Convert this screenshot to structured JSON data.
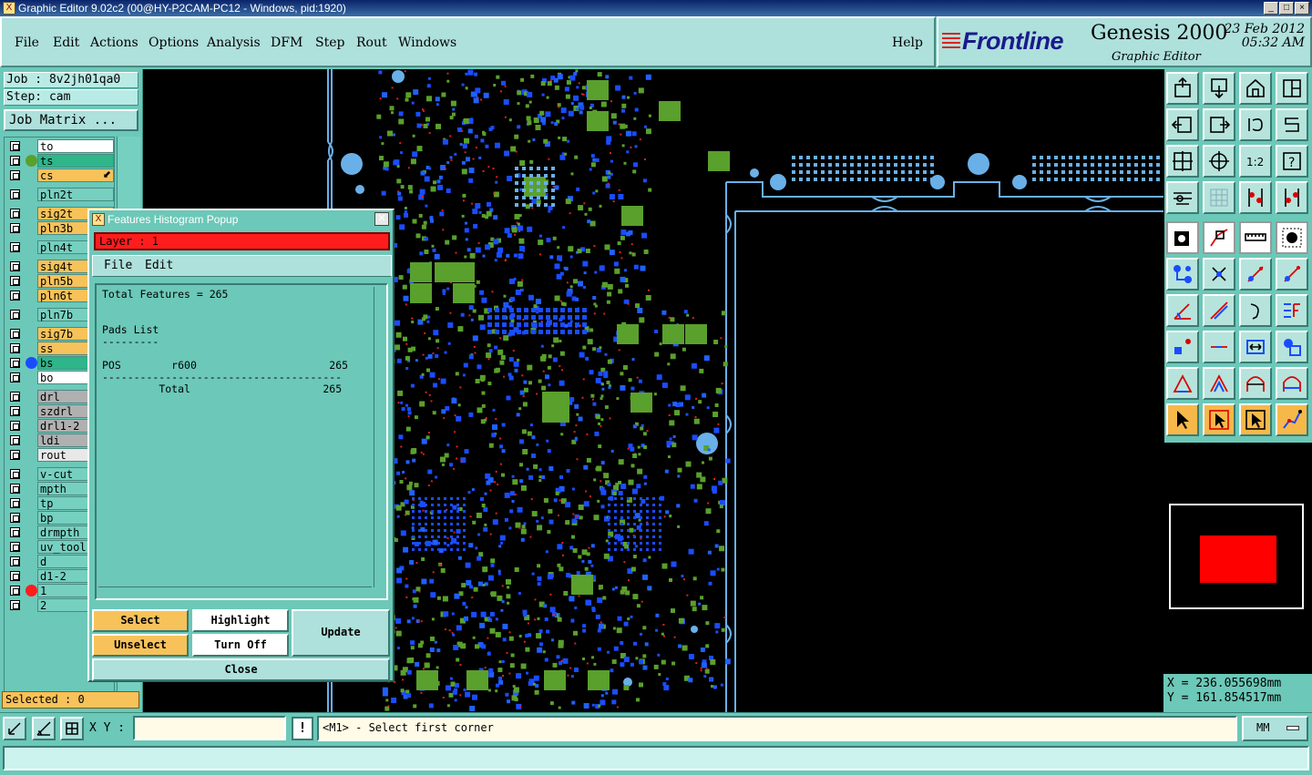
{
  "window": {
    "title": "Graphic Editor 9.02c2 (00@HY-P2CAM-PC12 - Windows, pid:1920)",
    "buttons": [
      "_",
      "□",
      "×"
    ]
  },
  "menu": {
    "items": [
      "File",
      "Edit",
      "Actions",
      "Options",
      "Analysis",
      "DFM",
      "Step",
      "Rout",
      "Windows"
    ],
    "help": "Help"
  },
  "brand": {
    "logo": "Frontline",
    "product": "Genesis 2000",
    "subtitle": "Graphic Editor",
    "date": "23 Feb 2012",
    "time": "05:32 AM"
  },
  "left": {
    "job": "Job : 8v2jh01qa0",
    "step": "Step: cam",
    "job_matrix": "Job Matrix ...",
    "selected": "Selected : 0",
    "layers": [
      {
        "name": "to",
        "bg": "#ffffff",
        "dot": ""
      },
      {
        "name": "ts",
        "bg": "#2fb58a",
        "dot": "#5aa02c"
      },
      {
        "name": "cs",
        "bg": "#f7c25a",
        "dot": "",
        "mark": "⬋"
      },
      {
        "name": "pln2t",
        "bg": "#76d0c0",
        "dot": ""
      },
      {
        "name": "sig2t",
        "bg": "#f7c25a",
        "dot": ""
      },
      {
        "name": "pln3b",
        "bg": "#f7c25a",
        "dot": ""
      },
      {
        "name": "pln4t",
        "bg": "#76d0c0",
        "dot": ""
      },
      {
        "name": "sig4t",
        "bg": "#f7c25a",
        "dot": ""
      },
      {
        "name": "pln5b",
        "bg": "#f7c25a",
        "dot": ""
      },
      {
        "name": "pln6t",
        "bg": "#f7c25a",
        "dot": ""
      },
      {
        "name": "pln7b",
        "bg": "#76d0c0",
        "dot": ""
      },
      {
        "name": "sig7b",
        "bg": "#f7c25a",
        "dot": ""
      },
      {
        "name": "ss",
        "bg": "#f7c25a",
        "dot": ""
      },
      {
        "name": "bs",
        "bg": "#2fb58a",
        "dot": "#1a4cff"
      },
      {
        "name": "bo",
        "bg": "#ffffff",
        "dot": ""
      },
      {
        "name": "drl",
        "bg": "#b0b0b0",
        "dot": ""
      },
      {
        "name": "szdrl",
        "bg": "#b0b0b0",
        "dot": ""
      },
      {
        "name": "drl1-2",
        "bg": "#b0b0b0",
        "dot": ""
      },
      {
        "name": "ldi",
        "bg": "#b0b0b0",
        "dot": ""
      },
      {
        "name": "rout",
        "bg": "#e8e8e8",
        "dot": ""
      },
      {
        "name": "v-cut",
        "bg": "#76d0c0",
        "dot": ""
      },
      {
        "name": "mpth",
        "bg": "#76d0c0",
        "dot": ""
      },
      {
        "name": "tp",
        "bg": "#76d0c0",
        "dot": ""
      },
      {
        "name": "bp",
        "bg": "#76d0c0",
        "dot": ""
      },
      {
        "name": "drmpth",
        "bg": "#76d0c0",
        "dot": ""
      },
      {
        "name": "uv_tool",
        "bg": "#76d0c0",
        "dot": ""
      },
      {
        "name": "d",
        "bg": "#76d0c0",
        "dot": ""
      },
      {
        "name": "d1-2",
        "bg": "#76d0c0",
        "dot": ""
      },
      {
        "name": "1",
        "bg": "#76d0c0",
        "dot": "#ff1c1c"
      },
      {
        "name": "2",
        "bg": "#76d0c0",
        "dot": ""
      }
    ]
  },
  "popup": {
    "title": "Features Histogram Popup",
    "layer": "Layer :  1",
    "menu": [
      "File",
      "Edit"
    ],
    "report": {
      "total": "Total Features = 265",
      "section": "Pads List",
      "underline": "---------",
      "row": {
        "type": "POS",
        "symbol": "r600",
        "count": "265"
      },
      "divider": "--------------------------------------",
      "total_label": "Total",
      "total_count": "265"
    },
    "buttons": {
      "select": "Select",
      "highlight": "Highlight",
      "update": "Update",
      "unselect": "Unselect",
      "turn_off": "Turn Off",
      "close": "Close"
    }
  },
  "right": {
    "x": "X = 236.055698mm",
    "y": "Y = 161.854517mm"
  },
  "bottom": {
    "xy_label": "X Y :",
    "xy_value": "",
    "bang": "!",
    "prompt": "<M1> - Select first corner",
    "units": "MM"
  }
}
